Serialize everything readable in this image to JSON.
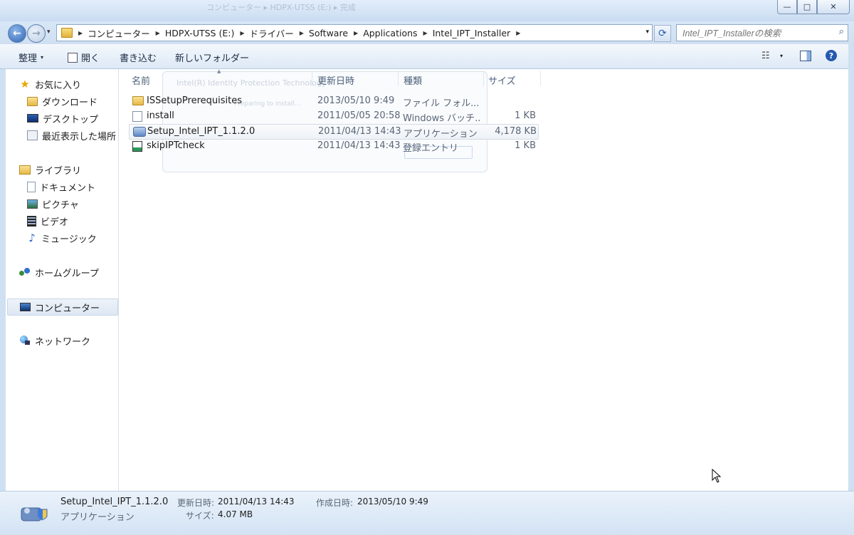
{
  "window": {
    "ghost_title": "コンピューター ▸ HDPX-UTSS (E:) ▸ 完成",
    "controls": {
      "minimize": "—",
      "maximize": "□",
      "close": "✕"
    }
  },
  "address_bar": {
    "back_icon": "←",
    "forward_icon": "→",
    "dropdown_icon": "▾",
    "breadcrumb": [
      "コンピューター",
      "HDPX-UTSS (E:)",
      "ドライバー",
      "Software",
      "Applications",
      "Intel_IPT_Installer"
    ],
    "separator": "▶",
    "refresh_icon": "⟳",
    "search_placeholder": "Intel_IPT_Installerの検索",
    "search_icon": "⌕"
  },
  "toolbar": {
    "organize": "整理",
    "open": "開く",
    "burn": "書き込む",
    "new_folder": "新しいフォルダー",
    "views_icon": "☷",
    "help_icon": "?"
  },
  "sidebar": {
    "favorites": "お気に入り",
    "downloads": "ダウンロード",
    "desktop": "デスクトップ",
    "recent": "最近表示した場所",
    "libraries": "ライブラリ",
    "documents": "ドキュメント",
    "pictures": "ピクチャ",
    "videos": "ビデオ",
    "music": "ミュージック",
    "homegroup": "ホームグループ",
    "computer": "コンピューター",
    "network": "ネットワーク"
  },
  "columns": {
    "name": "名前",
    "date": "更新日時",
    "type": "種類",
    "size": "サイズ"
  },
  "files": [
    {
      "name": "ISSetupPrerequisites",
      "date": "2013/05/10 9:49",
      "type": "ファイル フォル...",
      "size": "",
      "icon": "folder-icon"
    },
    {
      "name": "install",
      "date": "2011/05/05 20:58",
      "type": "Windows バッチ...",
      "size": "1 KB",
      "icon": "batch-file-icon"
    },
    {
      "name": "Setup_Intel_IPT_1.1.2.0",
      "date": "2011/04/13 14:43",
      "type": "アプリケーション",
      "size": "4,178 KB",
      "icon": "application-icon"
    },
    {
      "name": "skipIPTcheck",
      "date": "2011/04/13 14:43",
      "type": "登録エントリ",
      "size": "1 KB",
      "icon": "registry-icon"
    }
  ],
  "ghost_dialog": {
    "title": "Intel(R) Identity Protection Technology",
    "status": "Preparing to install..."
  },
  "details": {
    "name": "Setup_Intel_IPT_1.1.2.0",
    "type": "アプリケーション",
    "modified_label": "更新日時:",
    "modified_value": "2011/04/13 14:43",
    "created_label": "作成日時:",
    "created_value": "2013/05/10 9:49",
    "size_label": "サイズ:",
    "size_value": "4.07 MB"
  }
}
